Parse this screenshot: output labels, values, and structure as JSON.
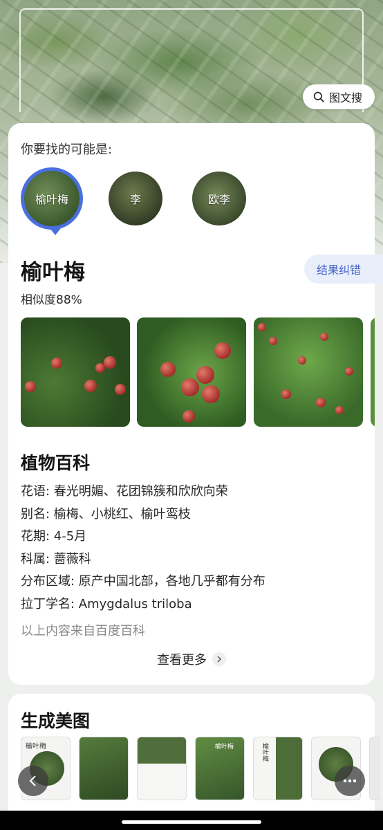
{
  "search_button": {
    "label": "图文搜",
    "icon": "search-icon"
  },
  "candidates_title": "你要找的可能是:",
  "candidates": [
    {
      "label": "榆叶梅",
      "selected": true
    },
    {
      "label": "李",
      "selected": false
    },
    {
      "label": "欧李",
      "selected": false
    }
  ],
  "result": {
    "name": "榆叶梅",
    "similarity": "相似度88%",
    "correct_button": "结果纠错"
  },
  "wiki": {
    "title": "植物百科",
    "rows": [
      "花语: 春光明媚、花团锦簇和欣欣向荣",
      "别名: 榆梅、小桃红、榆叶鸾枝",
      "花期: 4-5月",
      "科属: 蔷薇科",
      "分布区域: 原产中国北部，各地几乎都有分布",
      "拉丁学名: Amygdalus triloba"
    ],
    "source": "以上内容来自百度百科",
    "more": "查看更多"
  },
  "generate": {
    "title": "生成美图",
    "thumb_labels": [
      "榆叶梅",
      "榆叶梅",
      "榆叶梅"
    ]
  },
  "colors": {
    "accent": "#4a6fe0",
    "correct_bg": "#e9eefb",
    "correct_text": "#4466c6"
  }
}
